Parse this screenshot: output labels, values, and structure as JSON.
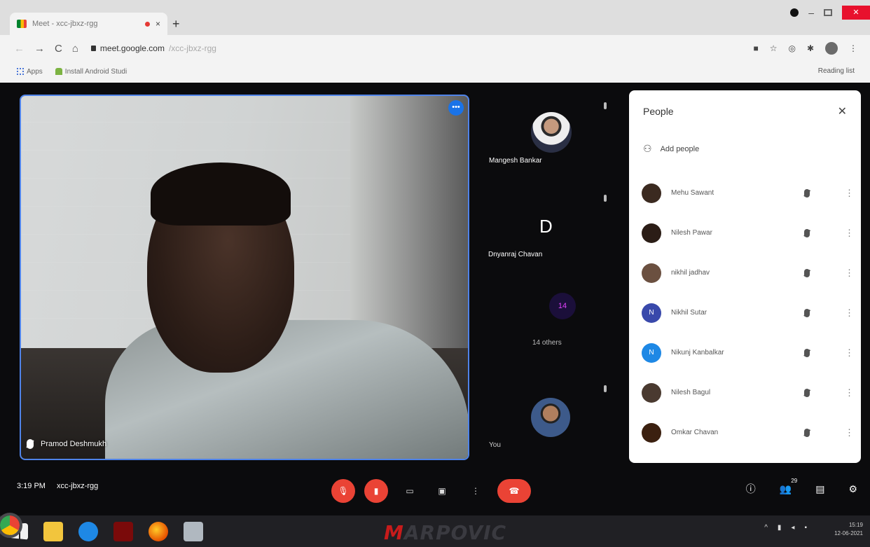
{
  "browser": {
    "tab_title": "Meet - xcc-jbxz-rgg",
    "tab_close": "×",
    "new_tab": "+",
    "url_host": "meet.google.com",
    "url_path": "/xcc-jbxz-rgg",
    "bookmarks": [
      "Apps",
      "Install Android Studi"
    ],
    "reading_list": "Reading list",
    "nav": {
      "back": "←",
      "forward": "→",
      "reload": "C",
      "home": "⌂"
    }
  },
  "meet": {
    "main_speaker": "Pramod Deshmukh",
    "main_more": "•••",
    "tiles": [
      {
        "name": "Mangesh Bankar"
      },
      {
        "name": "Dnyanraj Chavan",
        "initial": "D"
      },
      {
        "name": "14 others",
        "badge": "14"
      },
      {
        "name": "You"
      }
    ],
    "meeting_time": "3:19 PM",
    "meeting_code": "xcc-jbxz-rgg",
    "participant_count": "29"
  },
  "people_panel": {
    "title": "People",
    "close": "✕",
    "add_people": "Add people",
    "participants": [
      {
        "name": "Mehu Sawant",
        "color": "#3b2a20",
        "initial": ""
      },
      {
        "name": "Nilesh Pawar",
        "color": "#2b1d16",
        "initial": ""
      },
      {
        "name": "nikhil jadhav",
        "color": "#6b5040",
        "initial": ""
      },
      {
        "name": "Nikhil Sutar",
        "color": "#3949ab",
        "initial": "N"
      },
      {
        "name": "Nikunj Kanbalkar",
        "color": "#1e88e5",
        "initial": "N"
      },
      {
        "name": "Nilesh Bagul",
        "color": "#4a3a30",
        "initial": ""
      },
      {
        "name": "Omkar Chavan",
        "color": "#3b2010",
        "initial": ""
      }
    ]
  },
  "taskbar": {
    "brand_m": "M",
    "brand_rest": "ARPOVIC",
    "clock_time": "15:19",
    "clock_date": "12-06-2021"
  }
}
